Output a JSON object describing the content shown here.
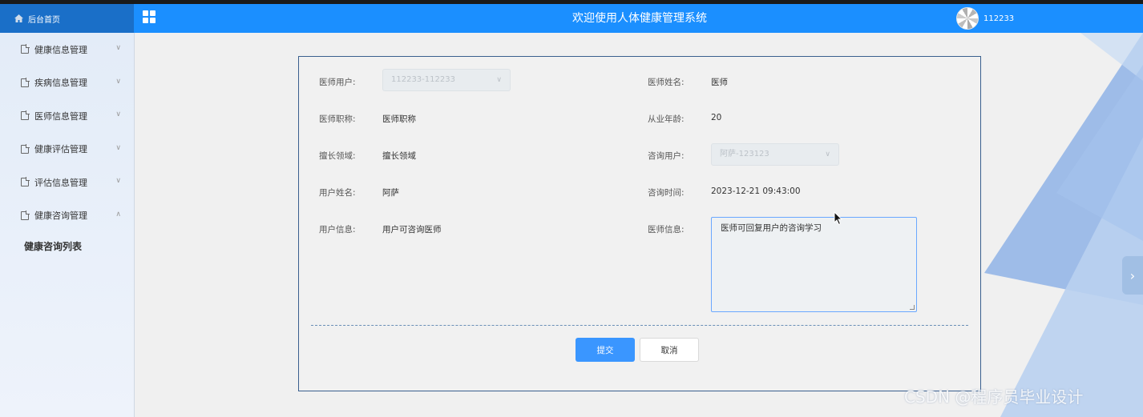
{
  "header": {
    "home_label": "后台首页",
    "title": "欢迎使用人体健康管理系统",
    "username": "112233",
    "color": "#1b8fff"
  },
  "sidebar": {
    "items": [
      {
        "label": "健康信息管理",
        "expanded": false
      },
      {
        "label": "疾病信息管理",
        "expanded": false
      },
      {
        "label": "医师信息管理",
        "expanded": false
      },
      {
        "label": "健康评估管理",
        "expanded": false
      },
      {
        "label": "评估信息管理",
        "expanded": false
      },
      {
        "label": "健康咨询管理",
        "expanded": true
      }
    ],
    "sub_item": "健康咨询列表"
  },
  "form": {
    "doctor_user": {
      "label": "医师用户:",
      "value": "112233-112233"
    },
    "doctor_name": {
      "label": "医师姓名:",
      "value": "医师"
    },
    "doctor_title": {
      "label": "医师职称:",
      "value": "医师职称"
    },
    "years": {
      "label": "从业年龄:",
      "value": "20"
    },
    "specialty": {
      "label": "擅长领域:",
      "value": "擅长领域"
    },
    "consult_user": {
      "label": "咨询用户:",
      "value": "阿萨-123123"
    },
    "user_name": {
      "label": "用户姓名:",
      "value": "阿萨"
    },
    "consult_time": {
      "label": "咨询时间:",
      "value": "2023-12-21 09:43:00"
    },
    "user_info": {
      "label": "用户信息:",
      "value": "用户可咨询医师"
    },
    "doctor_info": {
      "label": "医师信息:",
      "value": "医师可回复用户的咨询学习"
    },
    "submit_label": "提交",
    "cancel_label": "取消"
  },
  "watermark": "CSDN @程序员毕业设计",
  "icons": {
    "home": "home-icon",
    "grid": "grid-icon",
    "doc": "document-icon",
    "chevron": "chevron-down-icon",
    "arrow": "chevron-right-icon"
  }
}
